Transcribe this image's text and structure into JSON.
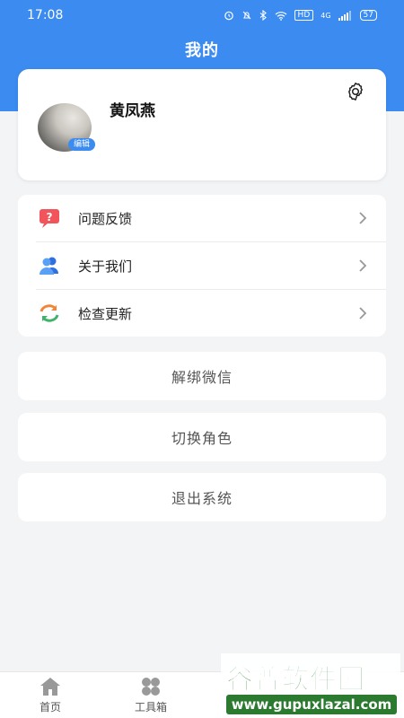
{
  "status_bar": {
    "time": "17:08",
    "network_badge": "HD",
    "signal_text": "4G",
    "battery": "57"
  },
  "header": {
    "title": "我的"
  },
  "profile": {
    "name": "黄凤燕",
    "edit_label": "编辑"
  },
  "menu": {
    "items": [
      {
        "label": "问题反馈",
        "icon": "feedback-icon"
      },
      {
        "label": "关于我们",
        "icon": "about-us-icon"
      },
      {
        "label": "检查更新",
        "icon": "update-icon"
      }
    ]
  },
  "actions": {
    "unbind_wechat": "解绑微信",
    "switch_role": "切换角色",
    "logout": "退出系统"
  },
  "bottom_nav": {
    "items": [
      {
        "label": "首页",
        "icon": "home-icon"
      },
      {
        "label": "工具箱",
        "icon": "toolbox-icon"
      }
    ]
  },
  "watermark": {
    "title": "谷普软件园",
    "url": "www.gupuxlazal.com"
  },
  "colors": {
    "brand_blue": "#3b8bf0",
    "background": "#f3f4f6"
  }
}
